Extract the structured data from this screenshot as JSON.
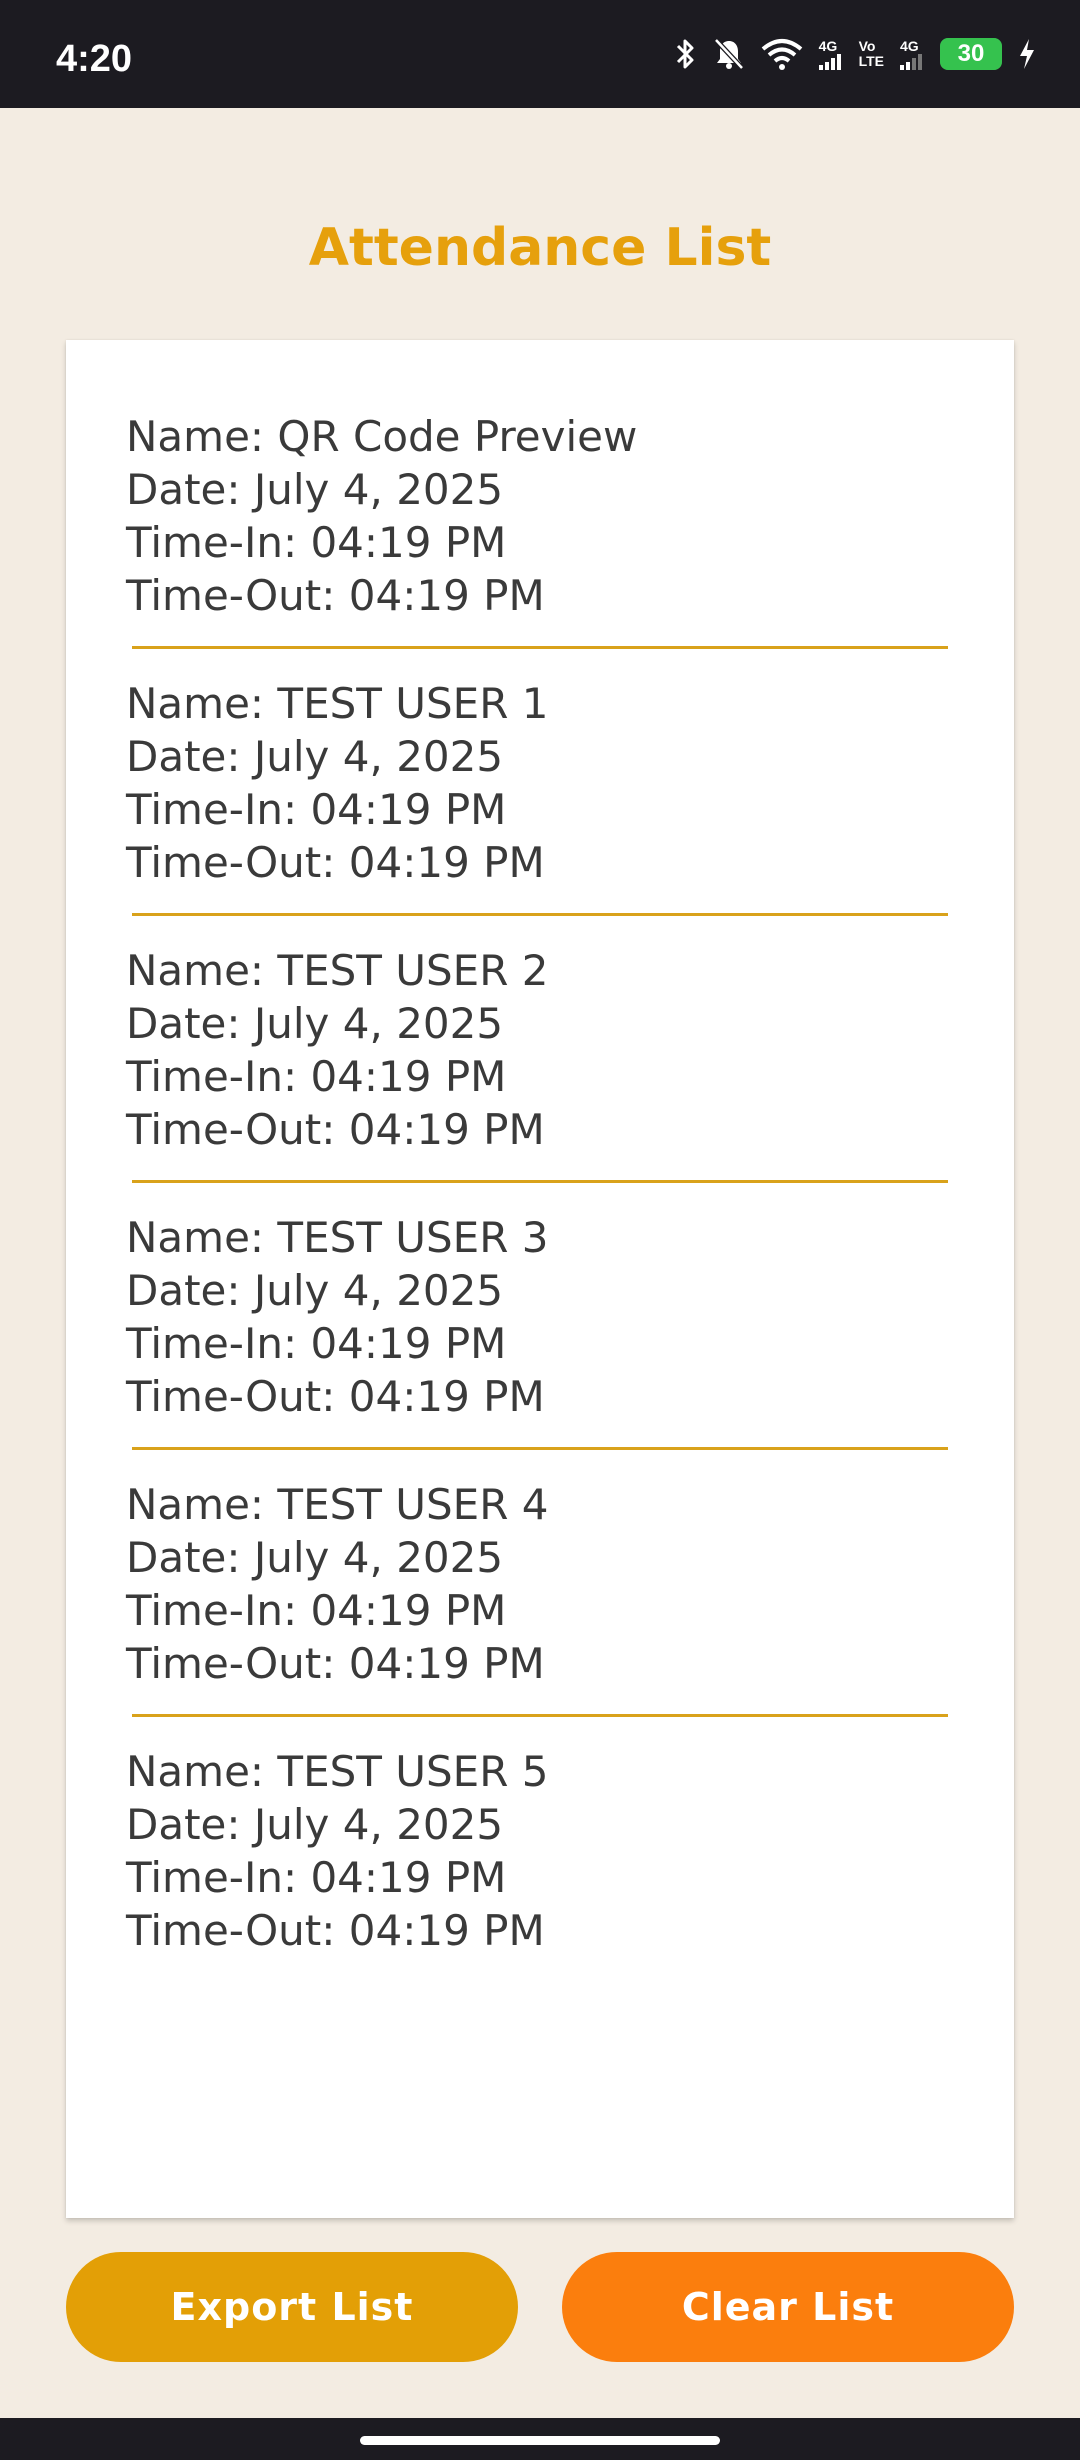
{
  "status_bar": {
    "time": "4:20",
    "net_1": "4G",
    "volte_top": "Vo",
    "volte_bottom": "LTE",
    "net_2": "4G",
    "battery": "30"
  },
  "page": {
    "title": "Attendance List"
  },
  "entries": [
    {
      "name": "Name: QR Code Preview",
      "date": "Date: July 4, 2025",
      "time_in": "Time-In: 04:19 PM",
      "time_out": "Time-Out: 04:19 PM"
    },
    {
      "name": "Name: TEST USER 1",
      "date": "Date: July 4, 2025",
      "time_in": "Time-In: 04:19 PM",
      "time_out": "Time-Out: 04:19 PM"
    },
    {
      "name": "Name: TEST USER 2",
      "date": "Date: July 4, 2025",
      "time_in": "Time-In: 04:19 PM",
      "time_out": "Time-Out: 04:19 PM"
    },
    {
      "name": "Name: TEST USER 3",
      "date": "Date: July 4, 2025",
      "time_in": "Time-In: 04:19 PM",
      "time_out": "Time-Out: 04:19 PM"
    },
    {
      "name": "Name: TEST USER 4",
      "date": "Date: July 4, 2025",
      "time_in": "Time-In: 04:19 PM",
      "time_out": "Time-Out: 04:19 PM"
    },
    {
      "name": "Name: TEST USER 5",
      "date": "Date: July 4, 2025",
      "time_in": "Time-In: 04:19 PM",
      "time_out": "Time-Out: 04:19 PM"
    }
  ],
  "buttons": {
    "export_label": "Export List",
    "clear_label": "Clear List"
  },
  "colors": {
    "title": "#e6a00c",
    "divider": "#d9a21b",
    "export_button": "#e39f06",
    "clear_button": "#fb7e0d",
    "background": "#f3ece2"
  },
  "icons": [
    "bluetooth-icon",
    "bell-off-icon",
    "wifi-icon",
    "signal-icon",
    "battery-icon",
    "charging-bolt-icon"
  ]
}
